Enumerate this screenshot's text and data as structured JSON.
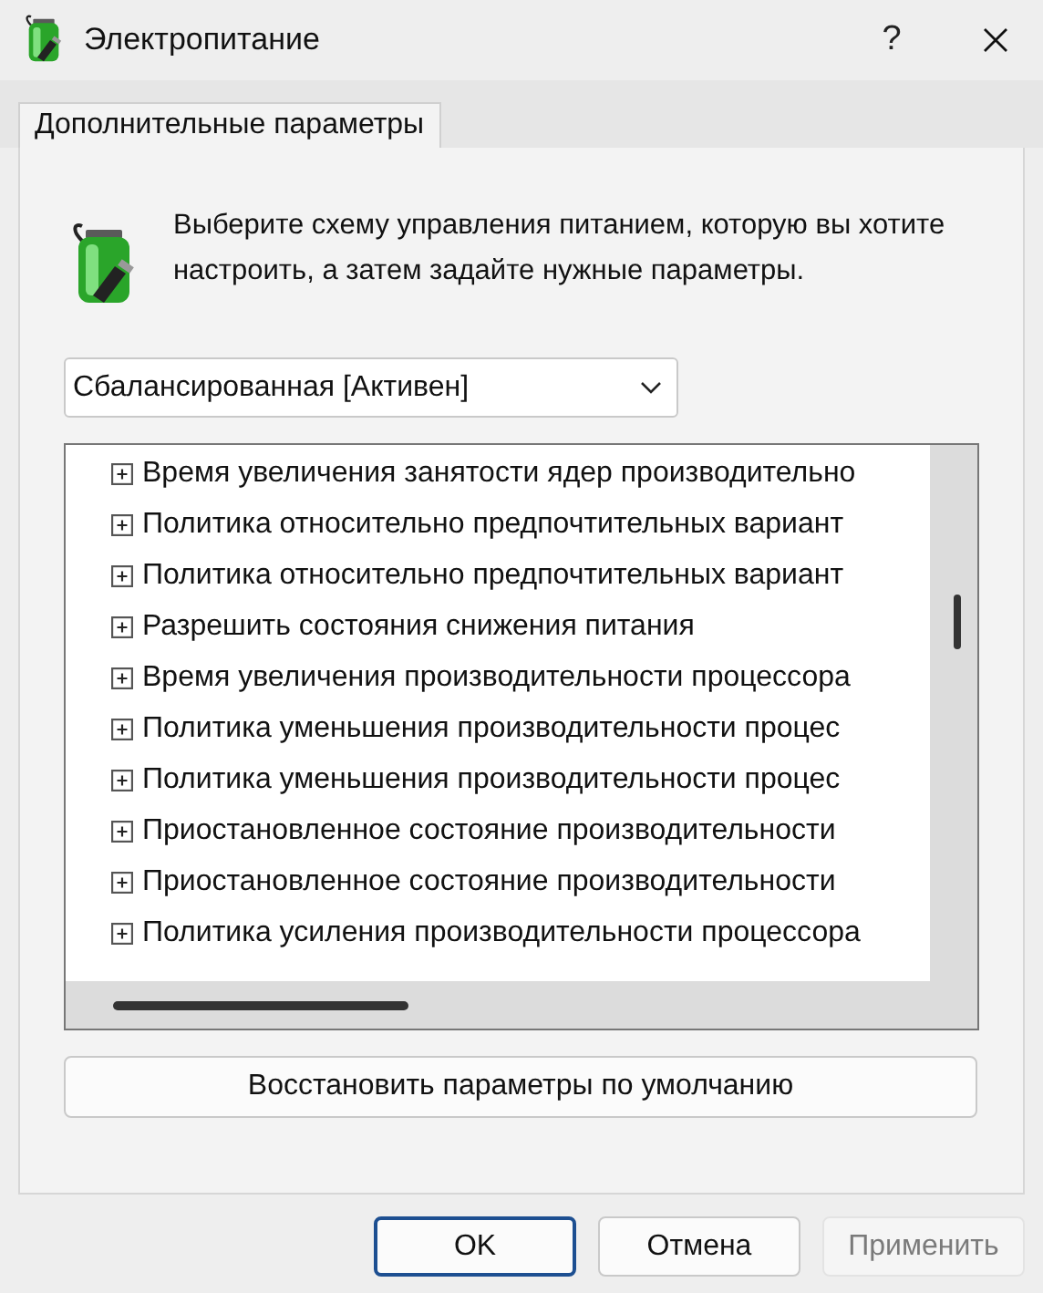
{
  "window": {
    "title": "Электропитание",
    "help": "?"
  },
  "tabs": [
    {
      "label": "Дополнительные параметры",
      "selected": true
    }
  ],
  "intro": "Выберите схему управления питанием, которую вы хотите настроить, а затем задайте нужные параметры.",
  "scheme": {
    "value": "Сбалансированная [Активен]"
  },
  "settings": [
    {
      "label": "Время увеличения занятости ядер производительно",
      "expanded": false
    },
    {
      "label": "Политика относительно предпочтительных вариант",
      "expanded": false
    },
    {
      "label": "Политика относительно предпочтительных вариант",
      "expanded": false
    },
    {
      "label": "Разрешить состояния снижения питания",
      "expanded": false
    },
    {
      "label": "Время увеличения производительности процессора",
      "expanded": false
    },
    {
      "label": "Политика уменьшения производительности процес",
      "expanded": false
    },
    {
      "label": "Политика уменьшения производительности процес",
      "expanded": false
    },
    {
      "label": "Приостановленное состояние производительности",
      "expanded": false
    },
    {
      "label": "Приостановленное состояние производительности",
      "expanded": false
    },
    {
      "label": "Политика усиления производительности процессора",
      "expanded": false
    }
  ],
  "restore_button": "Восстановить параметры по умолчанию",
  "buttons": [
    {
      "label": "OK",
      "default": true,
      "disabled": false
    },
    {
      "label": "Отмена",
      "default": false,
      "disabled": false
    },
    {
      "label": "Применить",
      "default": false,
      "disabled": true
    }
  ]
}
